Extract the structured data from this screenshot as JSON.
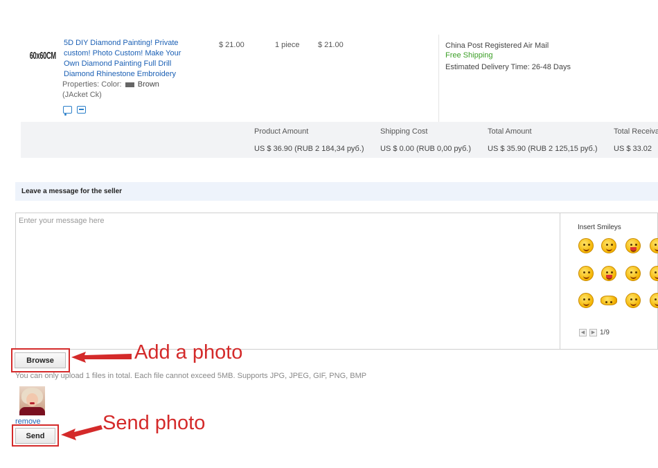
{
  "order_item": {
    "thumbnail_text": "60x60CM",
    "title": "5D DIY Diamond Painting! Private custom! Photo Custom! Make Your Own Diamond Painting Full Drill Diamond Rhinestone Embroidery",
    "properties_label": "Properties:",
    "color_label": "Color:",
    "color_value": "Brown",
    "color_extra": "(JAcket Ck)",
    "price": "$ 21.00",
    "quantity": "1 piece",
    "subtotal": "$ 21.00",
    "icons": [
      "truck-icon",
      "card-icon"
    ]
  },
  "shipping": {
    "method": "China Post Registered Air Mail",
    "cost_label": "Free Shipping",
    "delivery": "Estimated Delivery Time: 26-48 Days"
  },
  "summary": {
    "product_amount_label": "Product Amount",
    "product_amount_value": "US $ 36.90 (RUB 2 184,34 руб.)",
    "shipping_cost_label": "Shipping Cost",
    "shipping_cost_value": "US $ 0.00 (RUB 0,00 руб.)",
    "total_amount_label": "Total Amount",
    "total_amount_value": "US $ 35.90 (RUB 2 125,15 руб.)",
    "total_receivable_label": "Total Receiva",
    "total_receivable_value": "US $ 33.02"
  },
  "message": {
    "header": "Leave a message for the seller",
    "placeholder": "Enter your message here",
    "smileys_title": "Insert Smileys",
    "pager_text": "1/9",
    "prev_glyph": "◀",
    "next_glyph": "▶"
  },
  "upload": {
    "browse_label": "Browse",
    "note": "You can only upload 1 files in total. Each file cannot exceed 5MB. Supports JPG, JPEG, GIF, PNG, BMP",
    "remove_label": "remove",
    "send_label": "Send"
  },
  "annotations": {
    "add_photo": "Add a photo",
    "send_photo": "Send photo"
  },
  "colors": {
    "accent_red": "#d42a2a",
    "link_blue": "#1a5fb4",
    "free_green": "#3a9e25"
  }
}
